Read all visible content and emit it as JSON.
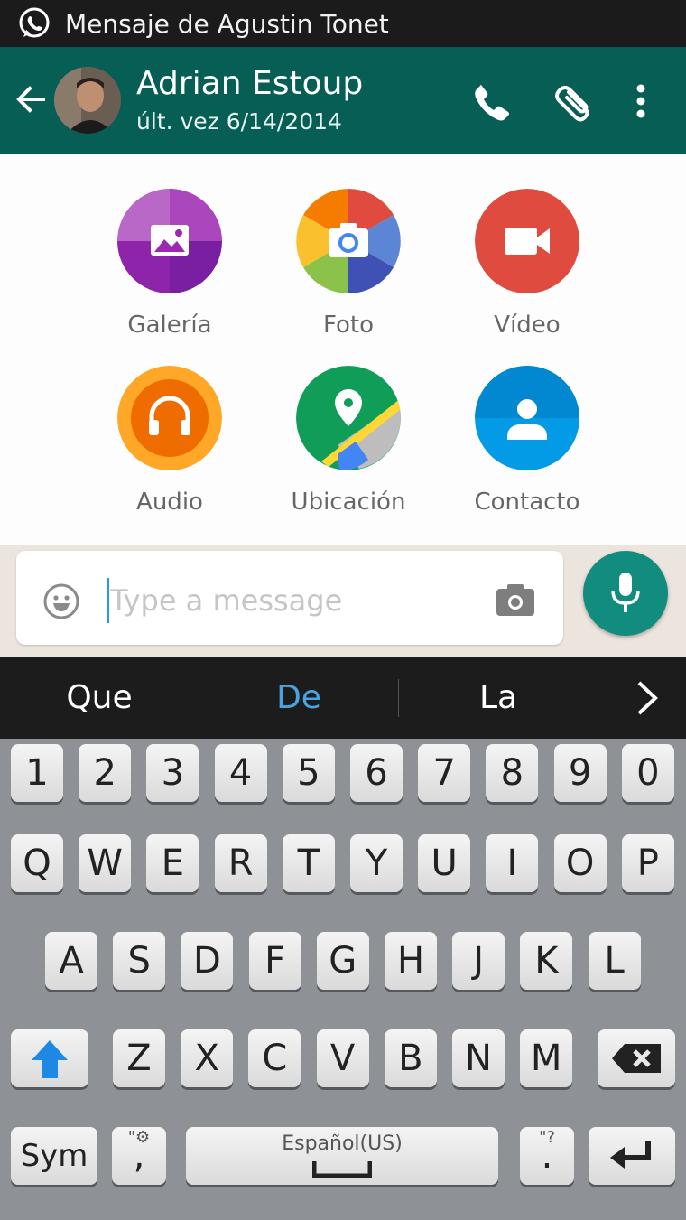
{
  "status_bar": {
    "notification": "Mensaje de Agustin Tonet",
    "app_icon": "whatsapp-icon"
  },
  "header": {
    "contact_name": "Adrian Estoup",
    "last_seen": "últ. vez 6/14/2014",
    "color": "#075e54",
    "icons": [
      "back-arrow-icon",
      "phone-icon",
      "paperclip-icon",
      "more-vert-icon"
    ]
  },
  "attach": {
    "items": [
      {
        "label": "Galería",
        "icon": "gallery-icon",
        "color": "#9c27b0"
      },
      {
        "label": "Foto",
        "icon": "camera-icon",
        "color": "#4285f4"
      },
      {
        "label": "Vídeo",
        "icon": "video-camera-icon",
        "color": "#e04b3f"
      },
      {
        "label": "Audio",
        "icon": "headphones-icon",
        "color": "#f57c00"
      },
      {
        "label": "Ubicación",
        "icon": "map-pin-icon",
        "color": "#0f9d58"
      },
      {
        "label": "Contacto",
        "icon": "person-icon",
        "color": "#039be5"
      }
    ]
  },
  "composer": {
    "placeholder": "Type a message",
    "value": "",
    "mic_color": "#128c7e"
  },
  "suggestions": {
    "items": [
      "Que",
      "De",
      "La"
    ],
    "active": "De"
  },
  "keyboard": {
    "numbers": [
      "1",
      "2",
      "3",
      "4",
      "5",
      "6",
      "7",
      "8",
      "9",
      "0"
    ],
    "row1": [
      "Q",
      "W",
      "E",
      "R",
      "T",
      "Y",
      "U",
      "I",
      "O",
      "P"
    ],
    "row2": [
      "A",
      "S",
      "D",
      "F",
      "G",
      "H",
      "J",
      "K",
      "L"
    ],
    "row3": [
      "Z",
      "X",
      "C",
      "V",
      "B",
      "N",
      "M"
    ],
    "sym": "Sym",
    "comma": ",",
    "comma_sub": "\"⚙",
    "space_label": "Español(US)",
    "period": ".",
    "period_sub": "\"?",
    "shift_color": "#1e88e5"
  }
}
